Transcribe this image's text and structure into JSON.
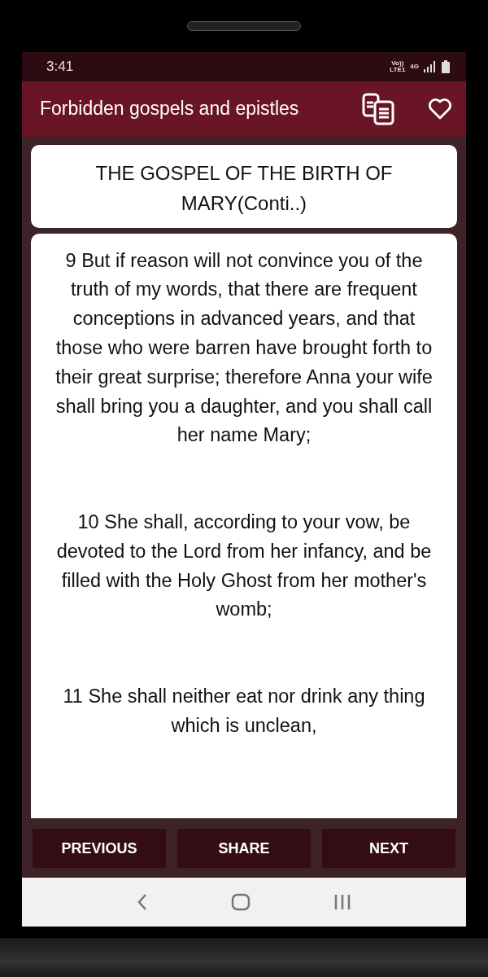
{
  "status_bar": {
    "time": "3:41",
    "volte": "Vo))",
    "lte": "LTE1",
    "network": "4G"
  },
  "app_bar": {
    "title": "Forbidden gospels and epistles"
  },
  "chapter_title": "THE GOSPEL OF THE BIRTH OF MARY(Conti..)",
  "verses": [
    "9 But if reason will not convince you of the truth of my words, that there are frequent conceptions in advanced years, and that those who were barren have brought forth to their great surprise; therefore Anna your wife shall bring you a daughter, and you shall call her name Mary;",
    "10 She shall, according to your vow, be devoted to the Lord from her infancy, and be filled with the Holy Ghost from her mother's womb;",
    "11 She shall neither eat nor drink any thing which is unclean,"
  ],
  "buttons": [
    "PREVIOUS",
    "SHARE",
    "NEXT"
  ]
}
